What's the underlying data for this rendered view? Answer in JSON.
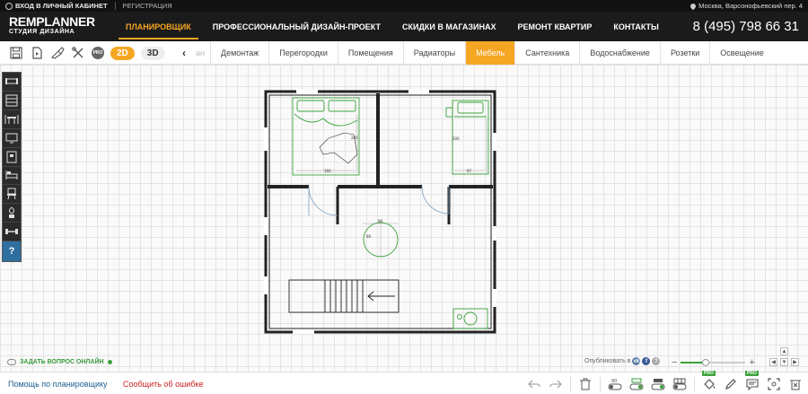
{
  "topbar": {
    "login": "ВХОД В ЛИЧНЫЙ КАБИНЕТ",
    "register": "РЕГИСТРАЦИЯ",
    "location": "Москва, Варсонофьевский пер. 4"
  },
  "brand": {
    "line1_rem": "REM",
    "line1_planner": "PLANNER",
    "line2": "СТУДИЯ ДИЗАЙНА"
  },
  "nav": {
    "items": [
      {
        "label": "Планировщик",
        "active": true
      },
      {
        "label": "Профессиональный дизайн-проект",
        "active": false
      },
      {
        "label": "Скидки в магазинах",
        "active": false
      },
      {
        "label": "Ремонт квартир",
        "active": false
      },
      {
        "label": "Контакты",
        "active": false
      }
    ],
    "phone": "8 (495) 798 66 31"
  },
  "toolbar": {
    "pro_label": "PRO",
    "mode_2d": "2D",
    "mode_3d": "3D",
    "prev_arrow": "‹",
    "faded_tab": "ан",
    "tabs": [
      {
        "label": "Демонтаж",
        "active": false
      },
      {
        "label": "Перегородки",
        "active": false
      },
      {
        "label": "Помещения",
        "active": false
      },
      {
        "label": "Радиаторы",
        "active": false
      },
      {
        "label": "Мебель",
        "active": true
      },
      {
        "label": "Сантехника",
        "active": false
      },
      {
        "label": "Водоснабжение",
        "active": false
      },
      {
        "label": "Розетки",
        "active": false
      },
      {
        "label": "Освещение",
        "active": false
      }
    ]
  },
  "palette": {
    "icons": [
      "sofa-icon",
      "wardrobe-icon",
      "dining-table-icon",
      "tv-icon",
      "cabinet-icon",
      "bed-icon",
      "chair-icon",
      "plant-icon",
      "gym-icon"
    ],
    "help": "?"
  },
  "plan": {
    "labels": {
      "bed1_width": "160",
      "bed1_length": "200",
      "bed2_width": "97",
      "bed2_length": "200",
      "table_width": "90",
      "table_depth": "90"
    }
  },
  "canvas_footer": {
    "ask_online": "ЗАДАТЬ ВОПРОС ОНЛАЙН",
    "publish_in": "Опубликовать в",
    "social": [
      "vk",
      "f",
      "?"
    ],
    "zoom_minus": "−",
    "zoom_plus": "+",
    "zoom_level": 0.38
  },
  "bottombar": {
    "help": "Помощь по планировщику",
    "report_error": "Сообщить об ошибке",
    "pro_label": "PRO"
  },
  "colors": {
    "accent": "#f5a623",
    "furniture": "#3aa23a",
    "wall": "#222222",
    "link": "#1a5c8c",
    "error": "#cc1f1f"
  }
}
